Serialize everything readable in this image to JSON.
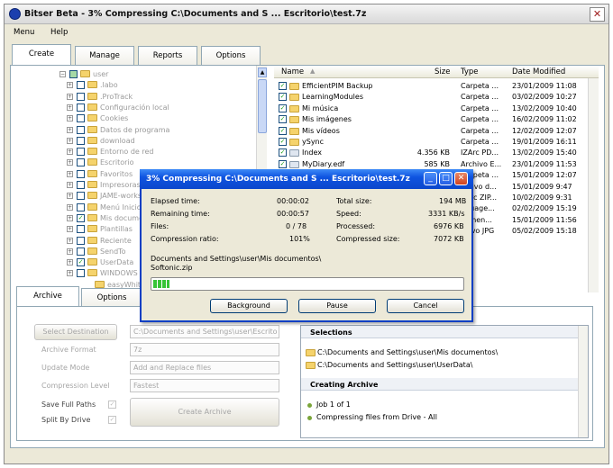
{
  "window": {
    "title": "Bitser Beta - 3% Compressing C:\\Documents and S ... Escritorio\\test.7z",
    "close": "✕"
  },
  "menu": [
    "Menu",
    "Help"
  ],
  "top_tabs": [
    "Create",
    "Manage",
    "Reports",
    "Options"
  ],
  "tree": {
    "items": [
      {
        "label": "user",
        "level": 0,
        "checked": "partial",
        "expander": "−"
      },
      {
        "label": ".labo",
        "level": 1,
        "checked": "no",
        "expander": "+"
      },
      {
        "label": ".ProTrack",
        "level": 1,
        "checked": "no",
        "expander": "+"
      },
      {
        "label": "Configuración local",
        "level": 1,
        "checked": "no",
        "expander": "+"
      },
      {
        "label": "Cookies",
        "level": 1,
        "checked": "no",
        "expander": "+"
      },
      {
        "label": "Datos de programa",
        "level": 1,
        "checked": "no",
        "expander": "+"
      },
      {
        "label": "download",
        "level": 1,
        "checked": "no",
        "expander": "+"
      },
      {
        "label": "Entorno de red",
        "level": 1,
        "checked": "no",
        "expander": "+"
      },
      {
        "label": "Escritorio",
        "level": 1,
        "checked": "no",
        "expander": "+"
      },
      {
        "label": "Favoritos",
        "level": 1,
        "checked": "no",
        "expander": "+"
      },
      {
        "label": "Impresoras",
        "level": 1,
        "checked": "no",
        "expander": "+"
      },
      {
        "label": "JAME-works",
        "level": 1,
        "checked": "no",
        "expander": "+"
      },
      {
        "label": "Menú Inicio",
        "level": 1,
        "checked": "no",
        "expander": "+"
      },
      {
        "label": "Mis documentos",
        "level": 1,
        "checked": "yes",
        "expander": "+"
      },
      {
        "label": "Plantillas",
        "level": 1,
        "checked": "no",
        "expander": "+"
      },
      {
        "label": "Reciente",
        "level": 1,
        "checked": "no",
        "expander": "+"
      },
      {
        "label": "SendTo",
        "level": 1,
        "checked": "no",
        "expander": "+"
      },
      {
        "label": "UserData",
        "level": 1,
        "checked": "yes",
        "expander": "+"
      },
      {
        "label": "WINDOWS",
        "level": 1,
        "checked": "no",
        "expander": "+"
      },
      {
        "label": "easyWhiteboard",
        "level": 2,
        "checked": "no",
        "expander": ""
      }
    ]
  },
  "filelist": {
    "headers": {
      "name": "Name",
      "size": "Size",
      "type": "Type",
      "date": "Date Modified"
    },
    "rows": [
      {
        "name": "EfficientPIM Backup",
        "size": "",
        "type": "Carpeta ...",
        "date": "23/01/2009 11:08"
      },
      {
        "name": "LearningModules",
        "size": "",
        "type": "Carpeta ...",
        "date": "03/02/2009 10:27"
      },
      {
        "name": "Mi música",
        "size": "",
        "type": "Carpeta ...",
        "date": "13/02/2009 10:40"
      },
      {
        "name": "Mis imágenes",
        "size": "",
        "type": "Carpeta ...",
        "date": "16/02/2009 11:02"
      },
      {
        "name": "Mis vídeos",
        "size": "",
        "type": "Carpeta ...",
        "date": "12/02/2009 12:07"
      },
      {
        "name": "ySync",
        "size": "",
        "type": "Carpeta ...",
        "date": "19/01/2009 16:11"
      },
      {
        "name": "Index",
        "size": "4.356 KB",
        "type": "IZArc PD...",
        "date": "13/02/2009 15:40"
      },
      {
        "name": "MyDiary.edf",
        "size": "585 KB",
        "type": "Archivo E...",
        "date": "23/01/2009 11:53"
      },
      {
        "name": "",
        "size": "",
        "type": "Carpeta ...",
        "date": "15/01/2009 12:07"
      },
      {
        "name": "",
        "size": "",
        "type": "rchivo d...",
        "date": "15/01/2009 9:47"
      },
      {
        "name": "",
        "size": "",
        "type": "ZArc ZIP...",
        "date": "10/02/2009 9:31"
      },
      {
        "name": "",
        "size": "",
        "type": "nguage...",
        "date": "02/02/2009 15:19"
      },
      {
        "name": "",
        "size": "",
        "type": "cumen...",
        "date": "15/01/2009 11:56"
      },
      {
        "name": "",
        "size": "",
        "type": "chivo JPG",
        "date": "05/02/2009 15:18"
      }
    ]
  },
  "bottom_tabs": [
    "Archive",
    "Options"
  ],
  "archive_form": {
    "select_destination": "Select Destination",
    "destination_value": "C:\\Documents and Settings\\user\\Escrito",
    "archive_format_label": "Archive Format",
    "archive_format_value": "7z",
    "update_mode_label": "Update Mode",
    "update_mode_value": "Add and Replace files",
    "compression_level_label": "Compression Level",
    "compression_level_value": "Fastest",
    "save_full_paths_label": "Save Full Paths",
    "split_by_drive_label": "Split By Drive",
    "create_archive": "Create Archive"
  },
  "selections": {
    "title": "Selections",
    "items": [
      "C:\\Documents and Settings\\user\\Mis documentos\\",
      "C:\\Documents and Settings\\user\\UserData\\"
    ],
    "creating_title": "Creating Archive",
    "creating_items": [
      "Job 1 of 1",
      "Compressing files from Drive - All"
    ]
  },
  "dialog": {
    "title": "3% Compressing C:\\Documents and S ... Escritorio\\test.7z",
    "left": [
      {
        "label": "Elapsed time:",
        "value": "00:00:02"
      },
      {
        "label": "Remaining time:",
        "value": "00:00:57"
      },
      {
        "label": "Files:",
        "value": "0 / 78"
      },
      {
        "label": "Compression ratio:",
        "value": "101%"
      }
    ],
    "right": [
      {
        "label": "Total size:",
        "value": "194 MB"
      },
      {
        "label": "Speed:",
        "value": "3331 KB/s"
      },
      {
        "label": "Processed:",
        "value": "6976 KB"
      },
      {
        "label": "Compressed size:",
        "value": "7072 KB"
      }
    ],
    "current_path": "Documents and Settings\\user\\Mis documentos\\",
    "current_file": "Softonic.zip",
    "progress_fraction": 0.03,
    "buttons": [
      "Background",
      "Pause",
      "Cancel"
    ]
  }
}
